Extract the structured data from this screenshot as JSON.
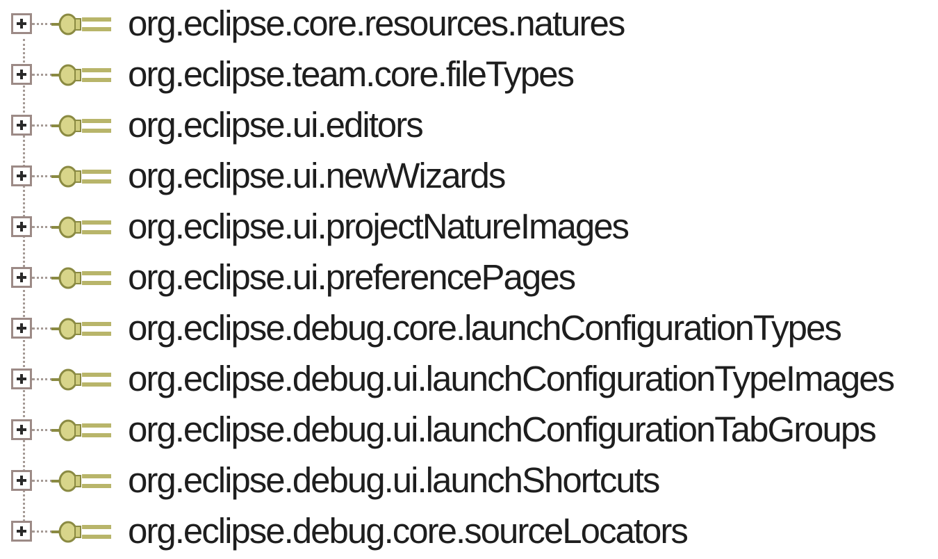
{
  "tree": {
    "items": [
      {
        "label": "org.eclipse.core.resources.natures"
      },
      {
        "label": "org.eclipse.team.core.fileTypes"
      },
      {
        "label": "org.eclipse.ui.editors"
      },
      {
        "label": "org.eclipse.ui.newWizards"
      },
      {
        "label": "org.eclipse.ui.projectNatureImages"
      },
      {
        "label": "org.eclipse.ui.preferencePages"
      },
      {
        "label": "org.eclipse.debug.core.launchConfigurationTypes"
      },
      {
        "label": "org.eclipse.debug.ui.launchConfigurationTypeImages"
      },
      {
        "label": "org.eclipse.debug.ui.launchConfigurationTabGroups"
      },
      {
        "label": "org.eclipse.debug.ui.launchShortcuts"
      },
      {
        "label": "org.eclipse.debug.core.sourceLocators"
      }
    ],
    "icon": "extension-point-plug-icon",
    "expander_icon": "plus-expander-icon"
  }
}
